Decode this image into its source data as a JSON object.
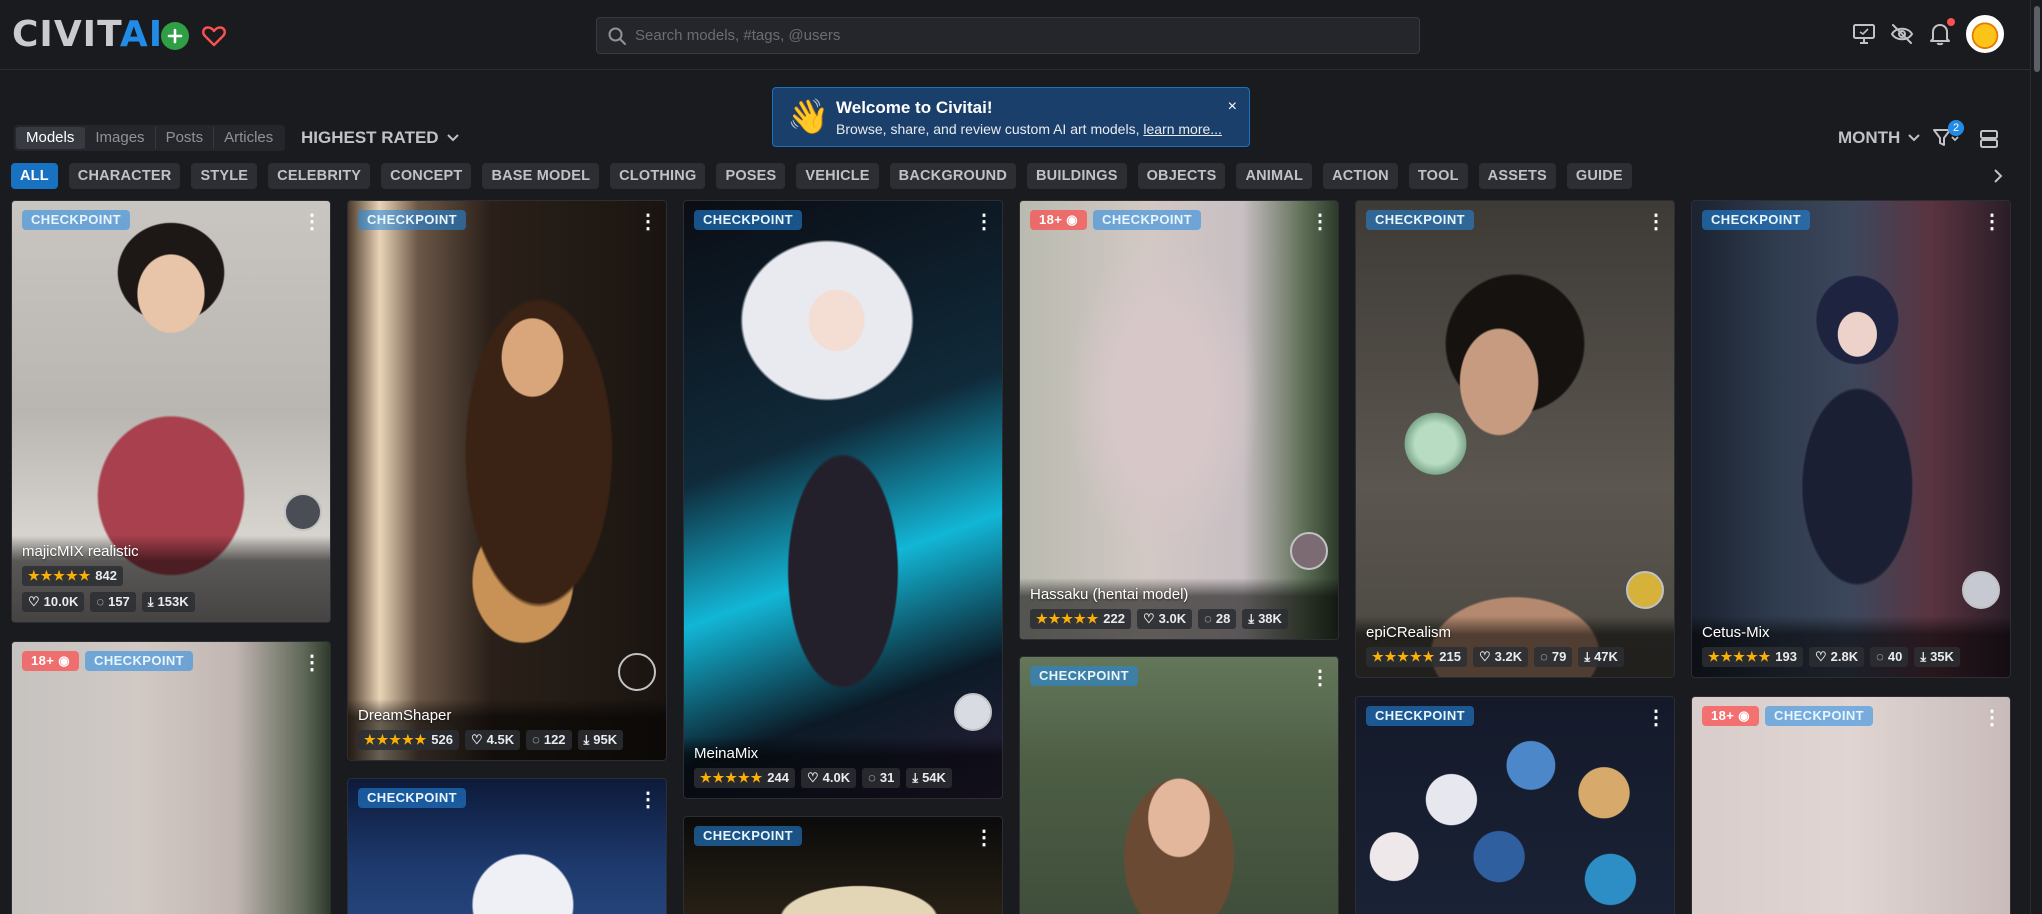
{
  "header": {
    "logo": "CIVITAI",
    "search_placeholder": "Search models, #tags, @users"
  },
  "banner": {
    "emoji": "👋",
    "title": "Welcome to Civitai!",
    "subtitle": "Browse, share, and review custom AI art models, ",
    "link": "learn more...",
    "close": "×"
  },
  "toolbar": {
    "tabs": [
      "Models",
      "Images",
      "Posts",
      "Articles"
    ],
    "active_tab": "Models",
    "sort": "HIGHEST RATED",
    "period": "MONTH",
    "filter_count": "2"
  },
  "categories": [
    "ALL",
    "CHARACTER",
    "STYLE",
    "CELEBRITY",
    "CONCEPT",
    "BASE MODEL",
    "CLOTHING",
    "POSES",
    "VEHICLE",
    "BACKGROUND",
    "BUILDINGS",
    "OBJECTS",
    "ANIMAL",
    "ACTION",
    "TOOL",
    "ASSETS",
    "GUIDE"
  ],
  "cards": [
    {
      "title": "majicMIX realistic",
      "type": "CHECKPOINT",
      "rating_count": "842",
      "likes": "10.0K",
      "comments": "157",
      "downloads": "153K",
      "nsfw": false
    },
    {
      "title": "DreamShaper",
      "type": "CHECKPOINT",
      "rating_count": "526",
      "likes": "4.5K",
      "comments": "122",
      "downloads": "95K",
      "nsfw": false
    },
    {
      "title": "MeinaMix",
      "type": "CHECKPOINT",
      "rating_count": "244",
      "likes": "4.0K",
      "comments": "31",
      "downloads": "54K",
      "nsfw": false
    },
    {
      "title": "Hassaku (hentai model)",
      "type": "CHECKPOINT",
      "rating_count": "222",
      "likes": "3.0K",
      "comments": "28",
      "downloads": "38K",
      "nsfw": true,
      "nsfw_label": "18+"
    },
    {
      "title": "epiCRealism",
      "type": "CHECKPOINT",
      "rating_count": "215",
      "likes": "3.2K",
      "comments": "79",
      "downloads": "47K",
      "nsfw": false
    },
    {
      "title": "Cetus-Mix",
      "type": "CHECKPOINT",
      "rating_count": "193",
      "likes": "2.8K",
      "comments": "40",
      "downloads": "35K",
      "nsfw": false
    },
    {
      "type": "CHECKPOINT",
      "nsfw": true,
      "nsfw_label": "18+"
    },
    {
      "type": "CHECKPOINT",
      "nsfw": false
    },
    {
      "type": "CHECKPOINT",
      "nsfw": false
    },
    {
      "type": "CHECKPOINT",
      "nsfw": false
    },
    {
      "type": "CHECKPOINT",
      "nsfw": false
    },
    {
      "type": "CHECKPOINT",
      "nsfw": true,
      "nsfw_label": "18+"
    }
  ],
  "stars": "★★★★★",
  "colors": {
    "accent": "#228be6",
    "background": "#1a1b1e",
    "star": "#fab005",
    "nsfw": "#fa5252"
  }
}
